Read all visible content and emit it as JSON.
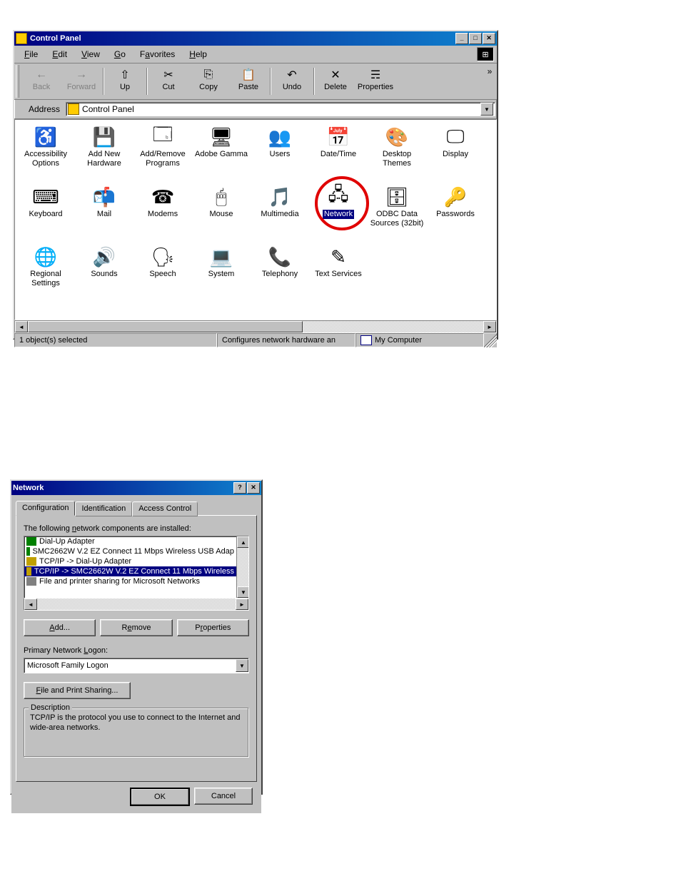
{
  "control_panel": {
    "title": "Control Panel",
    "menus": [
      "File",
      "Edit",
      "View",
      "Go",
      "Favorites",
      "Help"
    ],
    "menu_underlines": [
      "F",
      "E",
      "V",
      "G",
      "a",
      "H"
    ],
    "toolbar": [
      {
        "label": "Back",
        "glyph": "←",
        "disabled": true,
        "name": "back-button"
      },
      {
        "label": "Forward",
        "glyph": "→",
        "disabled": true,
        "name": "forward-button"
      },
      {
        "sep": true
      },
      {
        "label": "Up",
        "glyph": "⇧",
        "name": "up-button"
      },
      {
        "sep": true
      },
      {
        "label": "Cut",
        "glyph": "✂",
        "name": "cut-button"
      },
      {
        "label": "Copy",
        "glyph": "⎘",
        "name": "copy-button"
      },
      {
        "label": "Paste",
        "glyph": "📋",
        "name": "paste-button"
      },
      {
        "sep": true
      },
      {
        "label": "Undo",
        "glyph": "↶",
        "name": "undo-button"
      },
      {
        "sep": true
      },
      {
        "label": "Delete",
        "glyph": "✕",
        "name": "delete-button"
      },
      {
        "label": "Properties",
        "glyph": "☴",
        "name": "properties-button"
      }
    ],
    "address_label": "Address",
    "address_value": "Control Panel",
    "icons_row1": [
      {
        "label": "Accessibility Options",
        "glyph": "♿",
        "name": "accessibility-options-icon"
      },
      {
        "label": "Add New Hardware",
        "glyph": "💾",
        "name": "add-new-hardware-icon"
      },
      {
        "label": "Add/Remove Programs",
        "glyph": "🗔",
        "name": "add-remove-programs-icon"
      },
      {
        "label": "Adobe Gamma",
        "glyph": "🖥",
        "name": "adobe-gamma-icon"
      },
      {
        "label": "Users",
        "glyph": "👥",
        "name": "users-icon"
      },
      {
        "label": "Date/Time",
        "glyph": "📅",
        "name": "date-time-icon"
      },
      {
        "label": "Desktop Themes",
        "glyph": "🎨",
        "name": "desktop-themes-icon"
      },
      {
        "label": "Display",
        "glyph": "🖵",
        "name": "display-icon"
      }
    ],
    "icons_row2": [
      {
        "label": "Keyboard",
        "glyph": "⌨",
        "name": "keyboard-icon"
      },
      {
        "label": "Mail",
        "glyph": "📬",
        "name": "mail-icon"
      },
      {
        "label": "Modems",
        "glyph": "☎",
        "name": "modems-icon"
      },
      {
        "label": "Mouse",
        "glyph": "🖱",
        "name": "mouse-icon"
      },
      {
        "label": "Multimedia",
        "glyph": "🎵",
        "name": "multimedia-icon"
      },
      {
        "label": "Network",
        "glyph": "🖧",
        "name": "network-icon",
        "selected": true,
        "circled": true
      },
      {
        "label": "ODBC Data Sources (32bit)",
        "glyph": "🗄",
        "name": "odbc-icon"
      },
      {
        "label": "Passwords",
        "glyph": "🔑",
        "name": "passwords-icon"
      }
    ],
    "icons_row3": [
      {
        "label": "Regional Settings",
        "glyph": "🌐",
        "name": "regional-settings-icon"
      },
      {
        "label": "Sounds",
        "glyph": "🔊",
        "name": "sounds-icon"
      },
      {
        "label": "Speech",
        "glyph": "🗣",
        "name": "speech-icon"
      },
      {
        "label": "System",
        "glyph": "💻",
        "name": "system-icon"
      },
      {
        "label": "Telephony",
        "glyph": "📞",
        "name": "telephony-icon"
      },
      {
        "label": "Text Services",
        "glyph": "✎",
        "name": "text-services-icon"
      }
    ],
    "status_left": "1 object(s) selected",
    "status_mid": "Configures network hardware an",
    "status_right": "My Computer"
  },
  "network_dialog": {
    "title": "Network",
    "tabs": [
      "Configuration",
      "Identification",
      "Access Control"
    ],
    "active_tab_index": 0,
    "list_label": "The following network components are installed:",
    "components": [
      {
        "label": "Dial-Up Adapter",
        "icon": "li-green"
      },
      {
        "label": "SMC2662W V.2 EZ Connect 11 Mbps Wireless USB Adap",
        "icon": "li-green"
      },
      {
        "label": "TCP/IP -> Dial-Up Adapter",
        "icon": "li-proto"
      },
      {
        "label": "TCP/IP -> SMC2662W V.2 EZ Connect 11 Mbps Wireless",
        "icon": "li-proto",
        "selected": true
      },
      {
        "label": "File and printer sharing for Microsoft Networks",
        "icon": "li-share"
      }
    ],
    "buttons": {
      "add": "Add...",
      "remove": "Remove",
      "properties": "Properties"
    },
    "primary_logon_label": "Primary Network Logon:",
    "primary_logon_value": "Microsoft Family Logon",
    "file_print_sharing": "File and Print Sharing...",
    "description_label": "Description",
    "description_text": "TCP/IP is the protocol you use to connect to the Internet and wide-area networks.",
    "ok": "OK",
    "cancel": "Cancel"
  }
}
